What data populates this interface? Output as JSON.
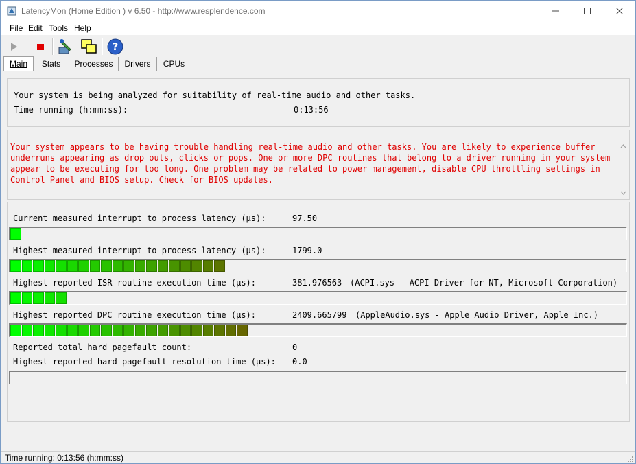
{
  "window": {
    "title": "LatencyMon  (Home Edition )  v 6.50 - http://www.resplendence.com",
    "minimize_icon": "minimize-icon",
    "maximize_icon": "maximize-icon",
    "close_icon": "close-icon"
  },
  "menu": [
    "File",
    "Edit",
    "Tools",
    "Help"
  ],
  "toolbar": {
    "start_icon": "play-icon",
    "stop_icon": "stop-icon",
    "tool_icon": "wrench-icon",
    "window_icon": "windows-icon",
    "help_icon": "help-icon"
  },
  "tabs": [
    "Main",
    "Stats",
    "Processes",
    "Drivers",
    "CPUs"
  ],
  "analysis": {
    "line1": "Your system is being analyzed for suitability of real-time audio and other tasks.",
    "time_label": "Time running (h:mm:ss):",
    "time_value": "0:13:56"
  },
  "warning": {
    "text": "Your system appears to be having trouble handling real-time audio and other tasks. You are likely to experience buffer underruns appearing as drop outs, clicks or pops. One or more DPC routines that belong to a driver running in your system appear to be executing for too long. One problem may be related to power management, disable CPU throttling settings in Control Panel and BIOS setup. Check for BIOS updates.",
    "color": "#e00000"
  },
  "metrics": {
    "current_latency": {
      "label": "Current measured interrupt to process latency (µs):",
      "value": "97.50",
      "segments": 1
    },
    "highest_latency": {
      "label": "Highest measured interrupt to process latency (µs):",
      "value": "1799.0",
      "segments": 19
    },
    "isr": {
      "label": "Highest reported ISR routine execution time (µs):",
      "value": "381.976563",
      "detail": "(ACPI.sys - ACPI Driver for NT, Microsoft Corporation)",
      "segments": 5
    },
    "dpc": {
      "label": "Highest reported DPC routine execution time (µs):",
      "value": "2409.665799",
      "detail": "(AppleAudio.sys - Apple Audio Driver, Apple Inc.)",
      "segments": 21
    },
    "pagefault_count": {
      "label": "Reported total hard pagefault count:",
      "value": "0"
    },
    "pagefault_time": {
      "label": "Highest reported hard pagefault resolution time (µs):",
      "value": "0.0",
      "segments": 0
    }
  },
  "colors": {
    "bar_start": "#00ff00",
    "bar_end": "#804000"
  },
  "status": {
    "text": "Time running: 0:13:56  (h:mm:ss)"
  }
}
